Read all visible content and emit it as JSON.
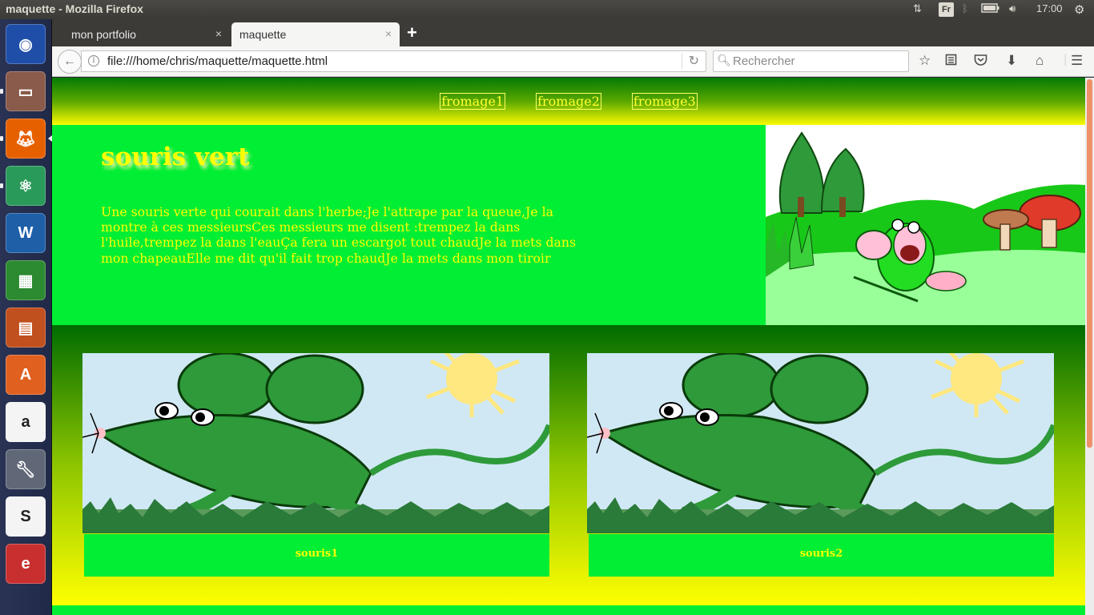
{
  "system": {
    "window_title": "maquette - Mozilla Firefox",
    "keyboard_layout": "Fr",
    "clock": "17:00"
  },
  "launcher": {
    "items": [
      {
        "name": "ubuntu-dash-icon",
        "color": "#1f4ea8"
      },
      {
        "name": "files-icon",
        "color": "#8a5a4a"
      },
      {
        "name": "firefox-icon",
        "color": "#e66000"
      },
      {
        "name": "atom-icon",
        "color": "#2a9a5a"
      },
      {
        "name": "writer-icon",
        "color": "#1e5fa8"
      },
      {
        "name": "calc-icon",
        "color": "#2c8a30"
      },
      {
        "name": "impress-icon",
        "color": "#c0501e"
      },
      {
        "name": "software-center-icon",
        "color": "#e06020"
      },
      {
        "name": "amazon-icon",
        "color": "#f4f4f4"
      },
      {
        "name": "system-settings-icon",
        "color": "#606878"
      },
      {
        "name": "slack-icon",
        "color": "#f4f4f4"
      },
      {
        "name": "evince-icon",
        "color": "#c83030"
      }
    ]
  },
  "browser": {
    "tabs": [
      {
        "label": "mon portfolio",
        "close": "×",
        "active": false
      },
      {
        "label": "maquette",
        "close": "×",
        "active": true
      }
    ],
    "new_tab": "+",
    "url": "file:///home/chris/maquette/maquette.html",
    "search_placeholder": "Rechercher"
  },
  "page": {
    "nav": [
      "fromage1",
      "fromage2",
      "fromage3"
    ],
    "hero_title": "souris vert",
    "hero_text": "Une souris verte qui courait dans l'herbe;Je l'attrape par la queue,Je la montre à ces messieursCes messieurs me disent :trempez la dans l'huile,trempez la dans l'eauÇa fera un escargot tout chaudJe la mets dans mon chapeauElle me dit qu'il fait trop chaudJe la mets dans mon tiroir",
    "gallery": [
      {
        "caption": "souris1"
      },
      {
        "caption": "souris2"
      }
    ],
    "colors": {
      "green": "#00ee33",
      "yellow": "#ffff00",
      "dark_green": "#047a05"
    }
  }
}
